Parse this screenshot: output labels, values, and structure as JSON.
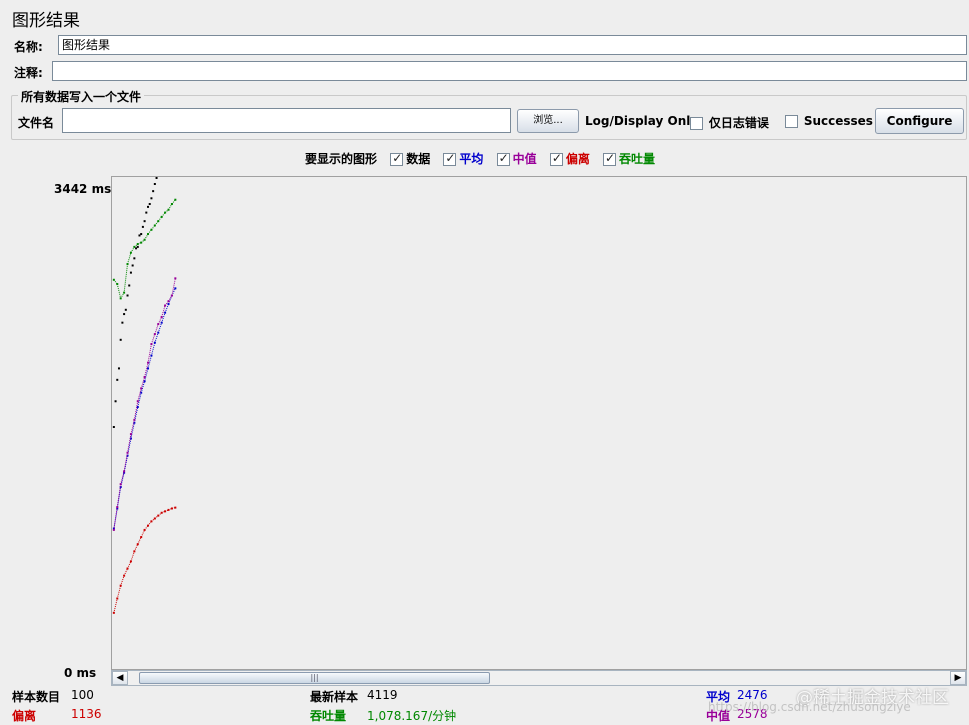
{
  "panel": {
    "title": "图形结果"
  },
  "name_row": {
    "label": "名称:",
    "value": "图形结果"
  },
  "comment_row": {
    "label": "注释:",
    "value": ""
  },
  "file_group": {
    "legend": "所有数据写入一个文件",
    "file_label": "文件名",
    "file_value": "",
    "browse_label": "浏览...",
    "log_display_label": "Log/Display Only:",
    "errors_only_label": "仅日志错误",
    "errors_only_checked": false,
    "successes_label": "Successes",
    "successes_checked": false,
    "configure_label": "Configure"
  },
  "graph_options": {
    "label": "要显示的图形",
    "items": [
      {
        "label": "数据",
        "checked": true,
        "color": "#000000"
      },
      {
        "label": "平均",
        "checked": true,
        "color": "#0000cc"
      },
      {
        "label": "中值",
        "checked": true,
        "color": "#990099"
      },
      {
        "label": "偏离",
        "checked": true,
        "color": "#cc0000"
      },
      {
        "label": "吞吐量",
        "checked": true,
        "color": "#008800"
      }
    ]
  },
  "chart_data": {
    "type": "scatter",
    "y_max_label": "3442 ms",
    "y_min_label": "0 ms",
    "ylim": [
      0,
      3442
    ],
    "xlim": [
      0,
      1000
    ],
    "series": [
      {
        "name": "数据",
        "color": "#000000",
        "x": [
          1,
          3,
          5,
          7,
          9,
          11,
          13,
          15,
          17,
          19,
          21,
          23,
          25,
          27,
          29,
          31,
          33,
          35,
          37,
          39,
          41,
          43,
          45,
          47,
          49,
          51
        ],
        "y": [
          1700,
          1880,
          2030,
          2110,
          2310,
          2430,
          2490,
          2520,
          2620,
          2690,
          2780,
          2830,
          2880,
          2950,
          2960,
          3040,
          3050,
          3100,
          3140,
          3200,
          3240,
          3260,
          3300,
          3350,
          3400,
          3442
        ]
      },
      {
        "name": "平均",
        "color": "#0000cc",
        "x": [
          1,
          5,
          9,
          13,
          17,
          21,
          25,
          29,
          33,
          37,
          41,
          45,
          49,
          53,
          57,
          61,
          65,
          69,
          73
        ],
        "y": [
          990,
          1130,
          1280,
          1380,
          1500,
          1620,
          1730,
          1840,
          1940,
          2020,
          2110,
          2200,
          2290,
          2360,
          2430,
          2500,
          2560,
          2620,
          2670
        ]
      },
      {
        "name": "中值",
        "color": "#990099",
        "x": [
          1,
          5,
          9,
          13,
          17,
          21,
          25,
          29,
          33,
          37,
          41,
          45,
          49,
          53,
          57,
          61,
          65,
          69,
          73
        ],
        "y": [
          980,
          1140,
          1300,
          1390,
          1520,
          1650,
          1750,
          1880,
          1970,
          2050,
          2150,
          2280,
          2350,
          2420,
          2470,
          2550,
          2580,
          2620,
          2740
        ]
      },
      {
        "name": "偏离",
        "color": "#cc0000",
        "x": [
          1,
          5,
          9,
          13,
          17,
          21,
          25,
          29,
          33,
          37,
          41,
          45,
          49,
          53,
          57,
          61,
          65,
          69,
          73
        ],
        "y": [
          400,
          500,
          590,
          660,
          710,
          760,
          830,
          880,
          930,
          980,
          1010,
          1040,
          1060,
          1080,
          1100,
          1110,
          1120,
          1130,
          1136
        ]
      },
      {
        "name": "吞吐量",
        "color": "#008800",
        "x": [
          1,
          5,
          9,
          13,
          17,
          21,
          25,
          29,
          33,
          37,
          41,
          45,
          49,
          53,
          57,
          61,
          65,
          69,
          73
        ],
        "y": [
          2730,
          2700,
          2600,
          2640,
          2840,
          2920,
          2960,
          2980,
          2990,
          3010,
          3050,
          3080,
          3110,
          3140,
          3170,
          3200,
          3220,
          3260,
          3290
        ]
      }
    ]
  },
  "stats": {
    "samples_label": "样本数目",
    "samples_value": "100",
    "deviation_label": "偏离",
    "deviation_value": "1136",
    "latest_label": "最新样本",
    "latest_value": "4119",
    "throughput_label": "吞吐量",
    "throughput_value": "1,078.167/分钟",
    "average_label": "平均",
    "average_value": "2476",
    "median_label": "中值",
    "median_value": "2578"
  },
  "colors": {
    "data": "#000000",
    "average": "#0000cc",
    "median": "#990099",
    "deviation": "#cc0000",
    "throughput": "#008800"
  },
  "watermark": {
    "main": "@稀土掘金技术社区",
    "sub": "https://blog.csdn.net/zhusongziye"
  }
}
